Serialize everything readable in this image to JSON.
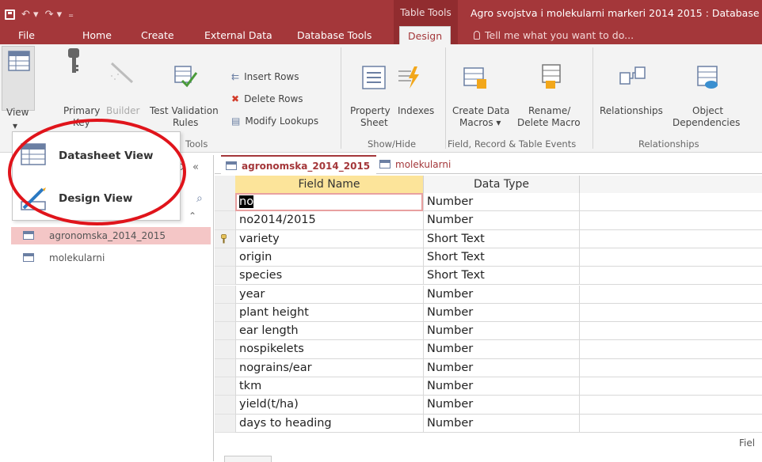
{
  "titlebar": {
    "contextual_label": "Table Tools",
    "app_title": "Agro svojstva i molekularni markeri 2014 2015 : Database"
  },
  "tabs": {
    "file": "File",
    "home": "Home",
    "create": "Create",
    "external_data": "External Data",
    "database_tools": "Database Tools",
    "design": "Design",
    "tell_me": "Tell me what you want to do..."
  },
  "ribbon": {
    "view": "View",
    "primary_key_line1": "Primary",
    "primary_key_line2": "Key",
    "builder": "Builder",
    "test_validation_line1": "Test Validation",
    "test_validation_line2": "Rules",
    "insert_rows": "Insert Rows",
    "delete_rows": "Delete Rows",
    "modify_lookups": "Modify Lookups",
    "tools_group": "Tools",
    "property_sheet_line1": "Property",
    "property_sheet_line2": "Sheet",
    "indexes": "Indexes",
    "show_hide_group": "Show/Hide",
    "create_data_macros_line1": "Create Data",
    "create_data_macros_line2": "Macros",
    "rename_delete_macro_line1": "Rename/",
    "rename_delete_macro_line2": "Delete Macro",
    "field_events_group": "Field, Record & Table Events",
    "relationships": "Relationships",
    "object_dependencies_line1": "Object",
    "object_dependencies_line2": "Dependencies",
    "relationships_group": "Relationships"
  },
  "view_menu": {
    "datasheet_view": "Datasheet View",
    "design_view": "Design View"
  },
  "nav": {
    "items": [
      {
        "label": "agronomska_2014_2015",
        "selected": true
      },
      {
        "label": "molekularni",
        "selected": false
      }
    ]
  },
  "doc_tabs": [
    {
      "label": "agronomska_2014_2015",
      "active": true
    },
    {
      "label": "molekularni",
      "active": false
    }
  ],
  "grid": {
    "header_field_name": "Field Name",
    "header_data_type": "Data Type",
    "rows": [
      {
        "name": "no",
        "type": "Number"
      },
      {
        "name": "no2014/2015",
        "type": "Number"
      },
      {
        "name": "variety",
        "type": "Short Text",
        "primary_key": true
      },
      {
        "name": "origin",
        "type": "Short Text"
      },
      {
        "name": "species",
        "type": "Short Text"
      },
      {
        "name": "year",
        "type": "Number"
      },
      {
        "name": "plant height",
        "type": "Number"
      },
      {
        "name": "ear length",
        "type": "Number"
      },
      {
        "name": "nospikelets",
        "type": "Number"
      },
      {
        "name": "nograins/ear",
        "type": "Number"
      },
      {
        "name": "tkm",
        "type": "Number"
      },
      {
        "name": "yield(t/ha)",
        "type": "Number"
      },
      {
        "name": "days to heading",
        "type": "Number"
      }
    ]
  },
  "status": {
    "field_properties_fragment": "Fiel"
  },
  "colors": {
    "accent": "#a4373a",
    "annotation_circle": "#e0141b",
    "selected_nav": "#f4c6c6",
    "field_header": "#fce49a"
  }
}
